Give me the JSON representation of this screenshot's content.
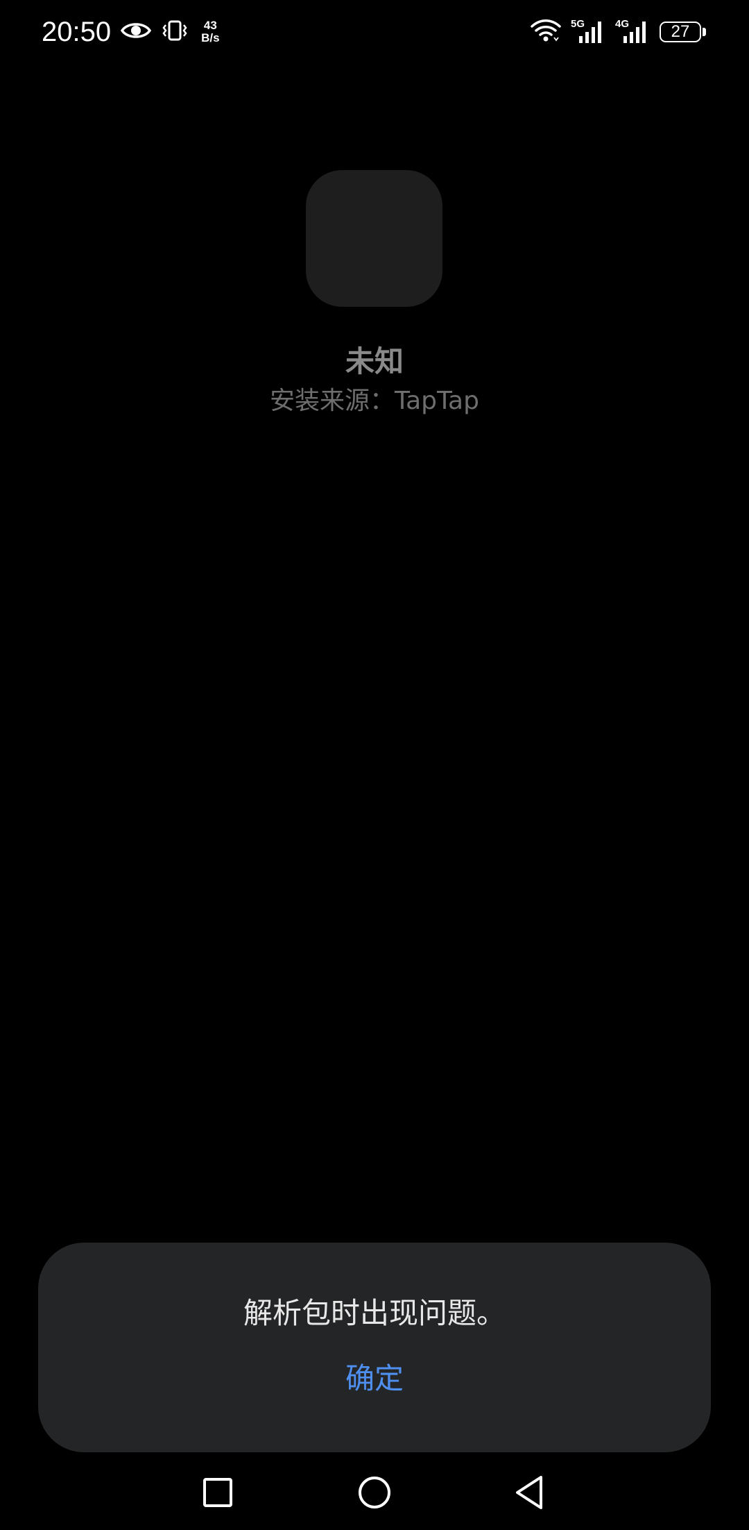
{
  "status_bar": {
    "time": "20:50",
    "net_speed_value": "43",
    "net_speed_unit": "B/s",
    "signal_1_label": "5G",
    "signal_2_label": "4G",
    "battery_level": "27",
    "icons": [
      "eye-icon",
      "vibrate-icon",
      "wifi-icon",
      "signal-5g-icon",
      "signal-4g-icon",
      "battery-icon"
    ]
  },
  "app_info": {
    "name": "未知",
    "install_source": "安装来源：TapTap"
  },
  "dialog": {
    "message": "解析包时出现问题。",
    "confirm_label": "确定",
    "accent_color": "#4f8ff0"
  },
  "nav_bar": {
    "icons": [
      "recents-icon",
      "home-icon",
      "back-icon"
    ]
  }
}
